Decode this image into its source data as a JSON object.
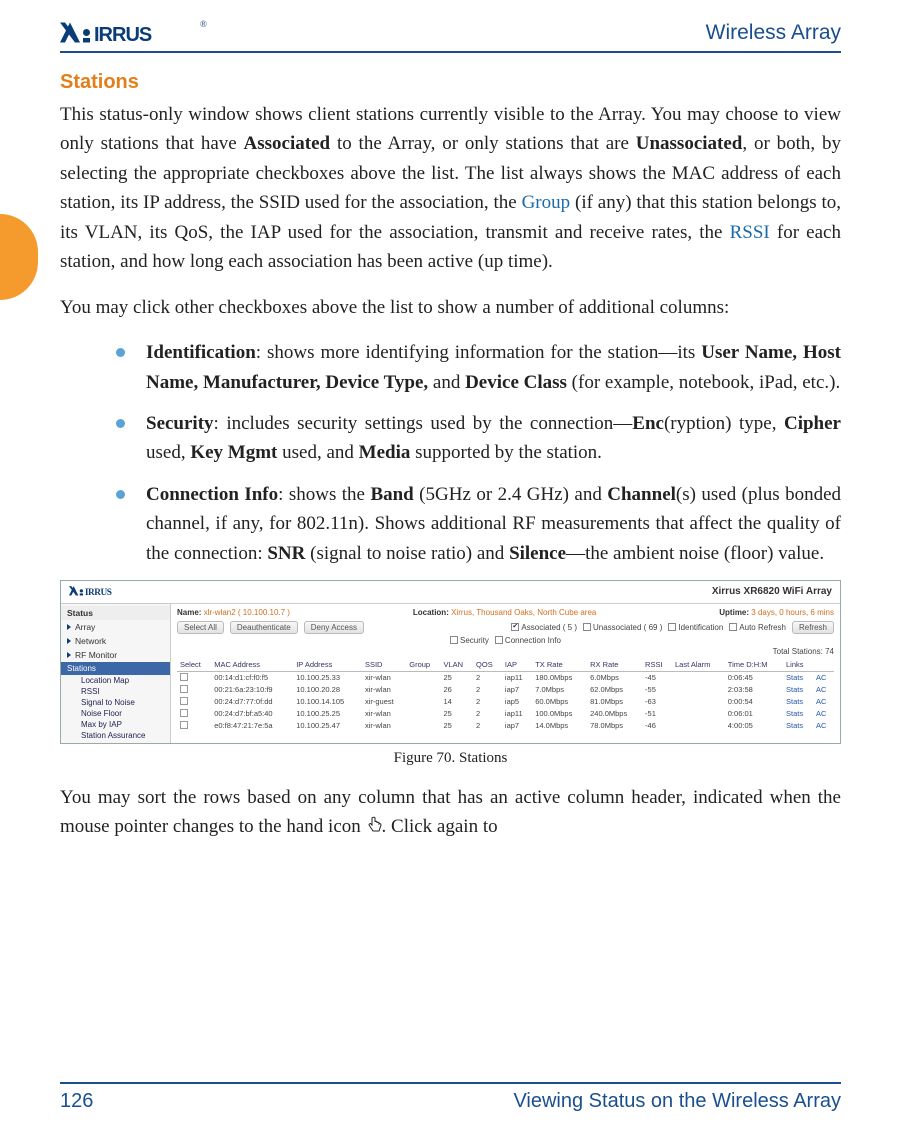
{
  "header": {
    "product": "Wireless Array"
  },
  "section": {
    "title": "Stations",
    "para1_a": "This status-only window shows client stations currently visible to the Array. You may choose to view only stations that have ",
    "para1_assoc": "Associated",
    "para1_b": " to the Array, or only stations that are ",
    "para1_unassoc": "Unassociated",
    "para1_c": ", or both, by selecting the appropriate checkboxes above the list. The list always shows the MAC address of each station, its IP address, the SSID used for the association, the ",
    "para1_group": "Group",
    "para1_d": " (if any) that this station belongs to, its VLAN, its QoS, the IAP used for the association, transmit and receive rates, the ",
    "para1_rssi": "RSSI",
    "para1_e": " for each station, and how long each association has been active (up time).",
    "para2": "You may click other checkboxes above the list to show a number of additional columns:",
    "bullets": {
      "b1_lead": "Identification",
      "b1_rest_a": ": shows more identifying information for the station—its ",
      "b1_fields": "User Name, Host Name, Manufacturer, Device Type,",
      "b1_and": " and ",
      "b1_class": "Device Class",
      "b1_rest_b": " (for example, notebook, iPad, etc.).",
      "b2_lead": "Security",
      "b2_rest_a": ": includes security settings used by the connection—",
      "b2_enc": "Enc",
      "b2_rest_b": "(ryption) type, ",
      "b2_cipher": "Cipher",
      "b2_rest_c": " used, ",
      "b2_key": "Key Mgmt",
      "b2_rest_d": " used, and ",
      "b2_media": "Media",
      "b2_rest_e": " supported by the station.",
      "b3_lead": "Connection Info",
      "b3_rest_a": ": shows the ",
      "b3_band": "Band",
      "b3_rest_b": " (5GHz or 2.4 GHz) and ",
      "b3_channel": "Channel",
      "b3_rest_c": "(s) used (plus bonded channel, if any, for 802.11n). Shows additional RF measurements that affect the quality of the connection: ",
      "b3_snr": "SNR",
      "b3_rest_d": " (signal to noise ratio) and ",
      "b3_silence": "Silence",
      "b3_rest_e": "—the ambient noise (floor) value."
    },
    "figure_caption": "Figure 70. Stations",
    "para3_a": "You may sort the rows based on any column that has an active column header, indicated when the mouse pointer changes to the hand icon ",
    "para3_b": ". Click again to"
  },
  "screenshot": {
    "title": "Xirrus XR6820 WiFi Array",
    "nav_header": "Status",
    "nav_items": [
      "Array",
      "Network",
      "RF Monitor"
    ],
    "nav_current": "Stations",
    "nav_sub": [
      "Location Map",
      "RSSI",
      "Signal to Noise",
      "Noise Floor",
      "Max by IAP",
      "Station Assurance"
    ],
    "meta": {
      "name_label": "Name:",
      "name_value": "xlr-wlan2  ( 10.100.10.7 )",
      "loc_label": "Location:",
      "loc_value": "Xirrus, Thousand Oaks, North Cube area",
      "up_label": "Uptime:",
      "up_value": "3 days, 0 hours, 6 mins"
    },
    "buttons": {
      "select_all": "Select All",
      "deauth": "Deauthenticate",
      "deny": "Deny Access",
      "refresh": "Refresh"
    },
    "checks": {
      "assoc": "Associated ( 5 )",
      "unassoc": "Unassociated ( 69 )",
      "ident": "Identification",
      "auto": "Auto Refresh",
      "sec": "Security",
      "conn": "Connection Info"
    },
    "total": "Total Stations: 74",
    "columns": [
      "Select",
      "MAC Address",
      "IP Address",
      "SSID",
      "Group",
      "VLAN",
      "QOS",
      "IAP",
      "TX Rate",
      "RX Rate",
      "RSSI",
      "Last Alarm",
      "Time D:H:M",
      "Links",
      ""
    ],
    "rows": [
      {
        "mac": "00:14:d1:cf:f0:f5",
        "ip": "10.100.25.33",
        "ssid": "xir-wlan",
        "vlan": "25",
        "qos": "2",
        "iap": "iap11",
        "tx": "180.0Mbps",
        "rx": "6.0Mbps",
        "rssi": "-45",
        "time": "0:06:45",
        "l1": "Stats",
        "l2": "AC"
      },
      {
        "mac": "00:21:6a:23:10:f9",
        "ip": "10.100.20.28",
        "ssid": "xir-wlan",
        "vlan": "26",
        "qos": "2",
        "iap": "iap7",
        "tx": "7.0Mbps",
        "rx": "62.0Mbps",
        "rssi": "-55",
        "time": "2:03:58",
        "l1": "Stats",
        "l2": "AC"
      },
      {
        "mac": "00:24:d7:77:0f:dd",
        "ip": "10.100.14.105",
        "ssid": "xir-guest",
        "vlan": "14",
        "qos": "2",
        "iap": "iap5",
        "tx": "60.0Mbps",
        "rx": "81.0Mbps",
        "rssi": "-63",
        "time": "0:00:54",
        "l1": "Stats",
        "l2": "AC"
      },
      {
        "mac": "00:24:d7:bf:a5:40",
        "ip": "10.100.25.25",
        "ssid": "xir-wlan",
        "vlan": "25",
        "qos": "2",
        "iap": "iap11",
        "tx": "100.0Mbps",
        "rx": "240.0Mbps",
        "rssi": "-51",
        "time": "0:06:01",
        "l1": "Stats",
        "l2": "AC"
      },
      {
        "mac": "e0:f8:47:21:7e:5a",
        "ip": "10.100.25.47",
        "ssid": "xir-wlan",
        "vlan": "25",
        "qos": "2",
        "iap": "iap7",
        "tx": "14.0Mbps",
        "rx": "78.0Mbps",
        "rssi": "-46",
        "time": "4:00:05",
        "l1": "Stats",
        "l2": "AC"
      }
    ]
  },
  "footer": {
    "page": "126",
    "crumb": "Viewing Status on the Wireless Array"
  }
}
